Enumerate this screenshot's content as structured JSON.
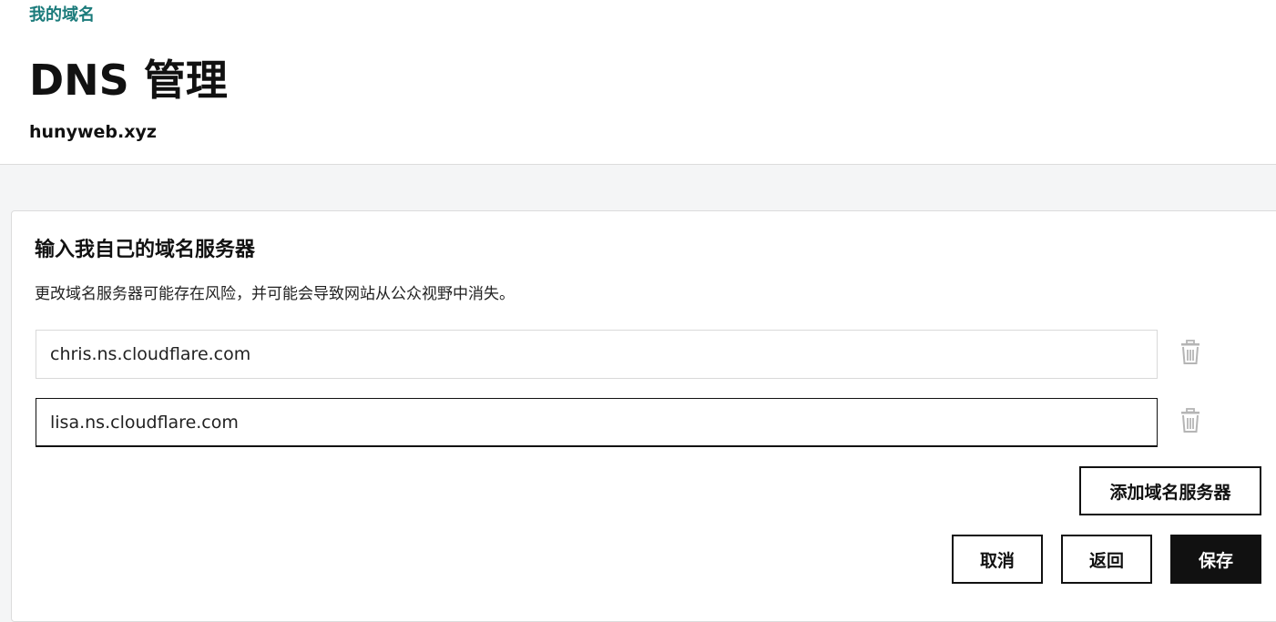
{
  "header": {
    "breadcrumb": "我的域名",
    "title": "DNS 管理",
    "domain": "hunyweb.xyz"
  },
  "nameservers": {
    "title": "输入我自己的域名服务器",
    "warning": "更改域名服务器可能存在风险，并可能会导致网站从公众视野中消失。",
    "entries": [
      {
        "value": "chris.ns.cloudflare.com",
        "delete_icon": "trash-icon"
      },
      {
        "value": "lisa.ns.cloudflare.com",
        "delete_icon": "trash-icon"
      }
    ],
    "add_label": "添加域名服务器"
  },
  "actions": {
    "cancel_label": "取消",
    "back_label": "返回",
    "save_label": "保存"
  },
  "colors": {
    "breadcrumb": "#1b7b7b",
    "primary_button": "#111111",
    "page_background": "#f4f5f6",
    "icon_gray": "#b5b5b5"
  }
}
